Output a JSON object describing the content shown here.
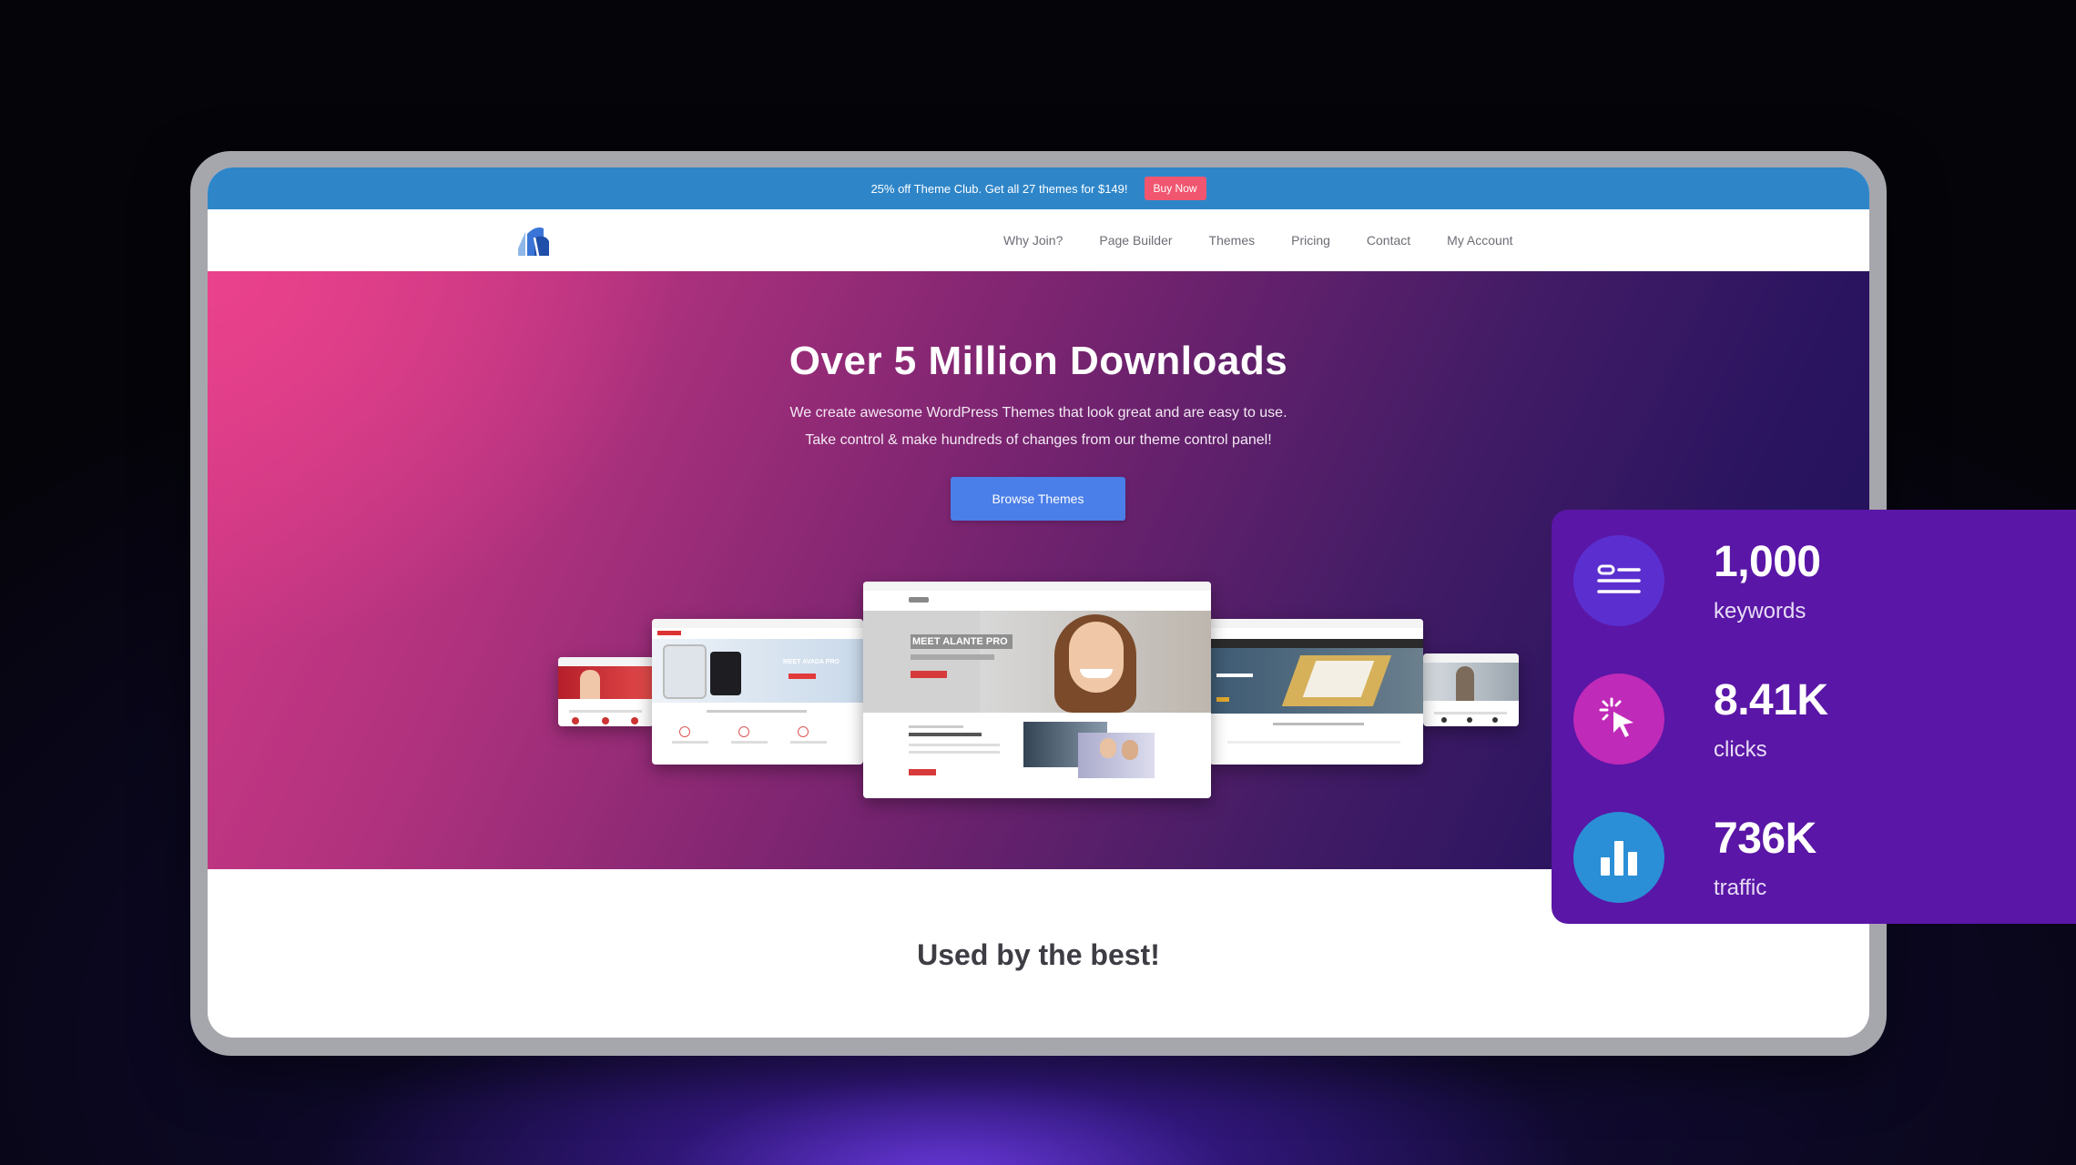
{
  "promo": {
    "text": "25% off Theme Club. Get all 27 themes for $149!",
    "button": "Buy Now"
  },
  "nav": {
    "items": [
      "Why Join?",
      "Page Builder",
      "Themes",
      "Pricing",
      "Contact",
      "My Account"
    ]
  },
  "hero": {
    "title": "Over 5 Million Downloads",
    "subtitle_line1": "We create awesome WordPress Themes that look great and are easy to use.",
    "subtitle_line2": "Take control & make hundreds of changes from our theme control panel!",
    "button": "Browse Themes",
    "preview_center_heading": "MEET ALANTE PRO",
    "preview_left_heading": "MEET AVADA PRO"
  },
  "section": {
    "title": "Used by the best!"
  },
  "stats": [
    {
      "value": "1,000",
      "label": "keywords",
      "icon": "list-icon",
      "color": "#5b2fcf"
    },
    {
      "value": "8.41K",
      "label": "clicks",
      "icon": "cursor-click-icon",
      "color": "#c02ab8"
    },
    {
      "value": "736K",
      "label": "traffic",
      "icon": "bar-chart-icon",
      "color": "#2a8fd6"
    }
  ],
  "colors": {
    "promo_bar": "#2e86c9",
    "buy_button": "#f0566f",
    "browse_button": "#4a7ee8",
    "stats_panel": "#5a16a6"
  }
}
